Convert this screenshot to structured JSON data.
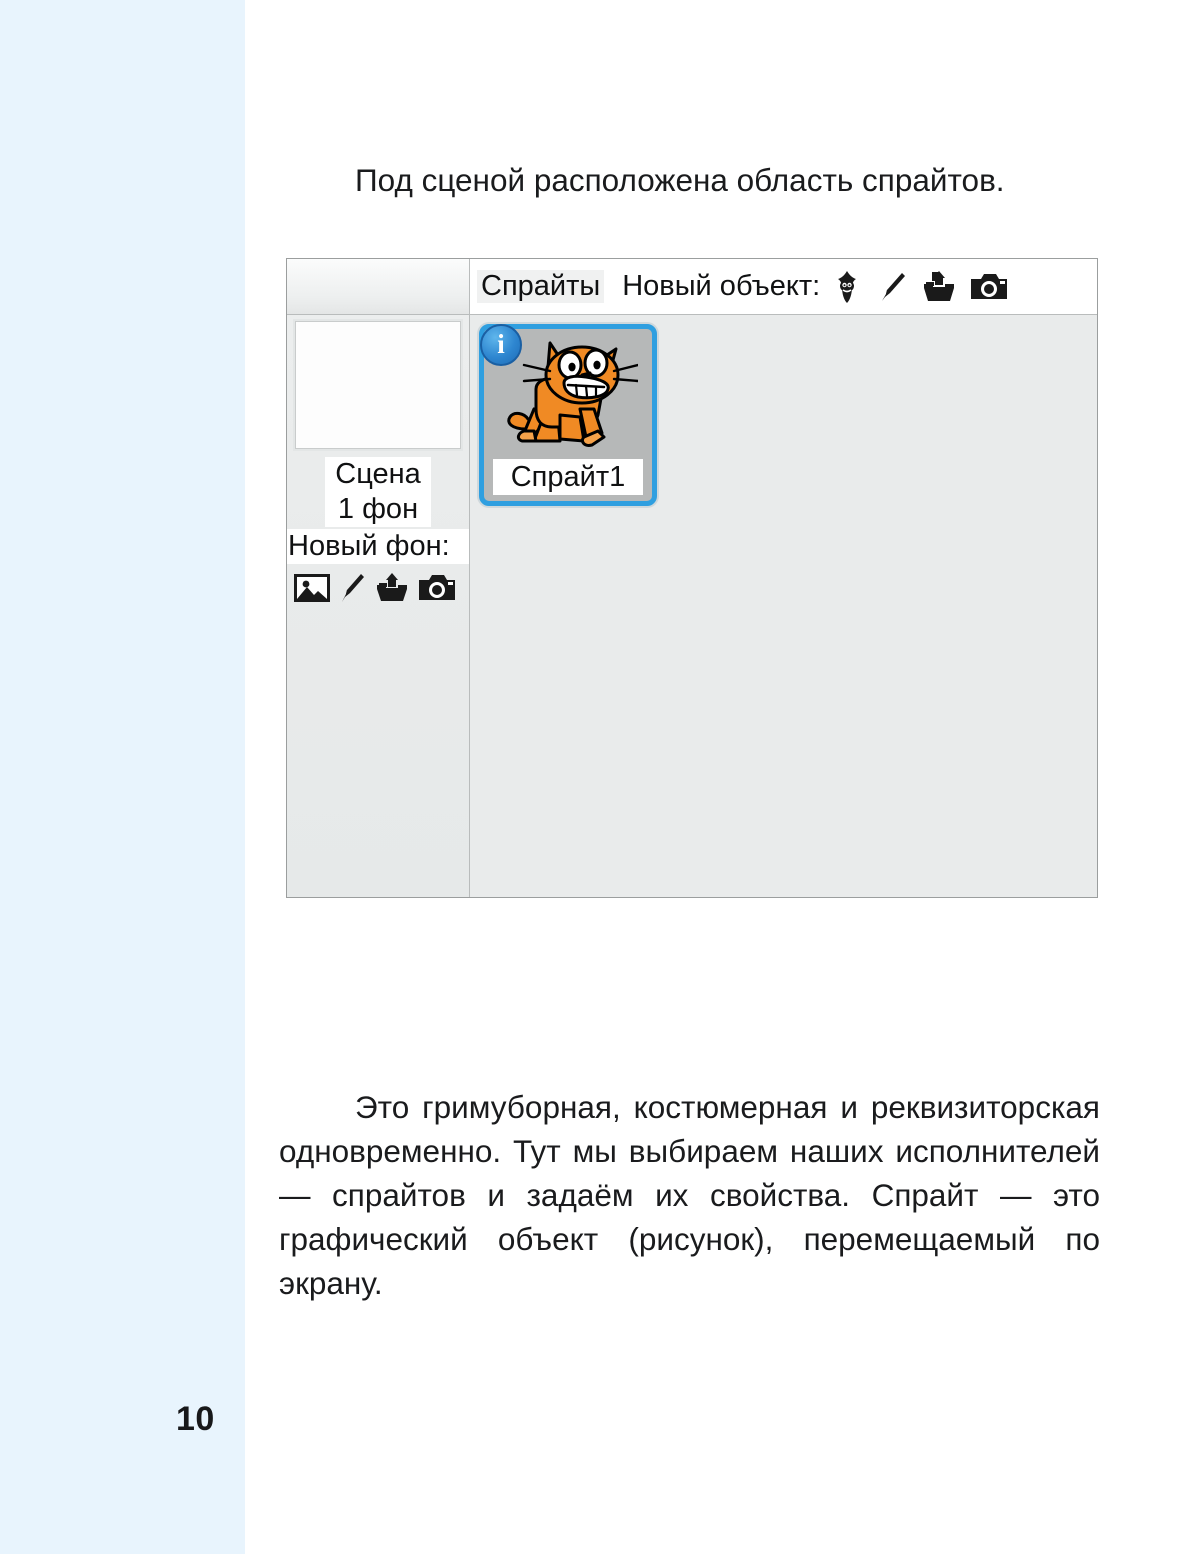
{
  "page": {
    "number": "10",
    "margin_color": "#e8f4fd",
    "background_color": "#ffffff"
  },
  "paragraph_top": {
    "text": "Под сценой расположена область спрайтов."
  },
  "paragraph_bottom": {
    "text": "Это гримуборная, костюмерная и реквизиторская одновременно. Тут мы выбираем наших исполнителей — спрайтов и задаём их свойства. Спрайт — это графический объект (рисунок), перемещаемый по экрану."
  },
  "screenshot": {
    "accent_color": "#2f9fe0",
    "panel_background": "#e9ebeb",
    "toolbar": {
      "sprites_label": "Спрайты",
      "new_object_label": "Новый объект:",
      "icons": [
        {
          "name": "new-sprite-character-icon",
          "title": "Новый спрайт"
        },
        {
          "name": "paint-brush-icon",
          "title": "Нарисовать"
        },
        {
          "name": "upload-folder-icon",
          "title": "Загрузить"
        },
        {
          "name": "camera-icon",
          "title": "Камера"
        }
      ]
    },
    "stage_panel": {
      "name": "Сцена",
      "backdrop_count": "1 фон",
      "new_backdrop_label": "Новый фон:",
      "icons": [
        {
          "name": "image-picture-icon",
          "title": "Выбрать фон"
        },
        {
          "name": "paint-brush-icon",
          "title": "Нарисовать фон"
        },
        {
          "name": "upload-folder-icon",
          "title": "Загрузить фон"
        },
        {
          "name": "camera-icon",
          "title": "Камера"
        }
      ]
    },
    "sprites": [
      {
        "name": "Спрайт1",
        "selected": true,
        "badge": "i",
        "thumbnail": "scratch-cat-icon"
      }
    ]
  }
}
